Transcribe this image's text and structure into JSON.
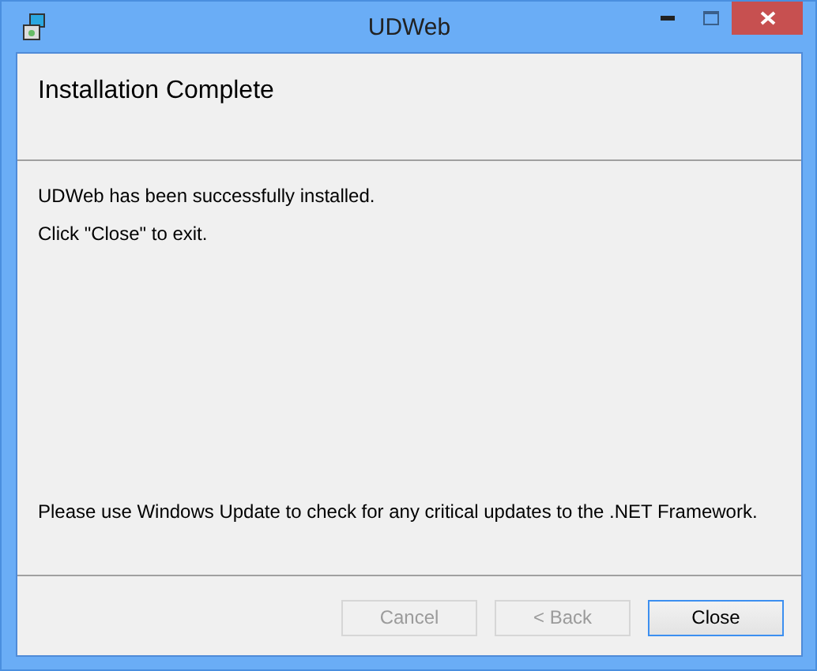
{
  "window": {
    "title": "UDWeb"
  },
  "header": {
    "title": "Installation Complete"
  },
  "messages": [
    "UDWeb has been successfully installed.",
    "Click \"Close\" to exit."
  ],
  "note": "Please use Windows Update to check for any critical updates to the .NET Framework.",
  "buttons": [
    {
      "label": "Cancel",
      "disabled": true,
      "focused": false
    },
    {
      "label": "< Back",
      "disabled": true,
      "focused": false
    },
    {
      "label": "Close",
      "disabled": false,
      "focused": true
    }
  ]
}
